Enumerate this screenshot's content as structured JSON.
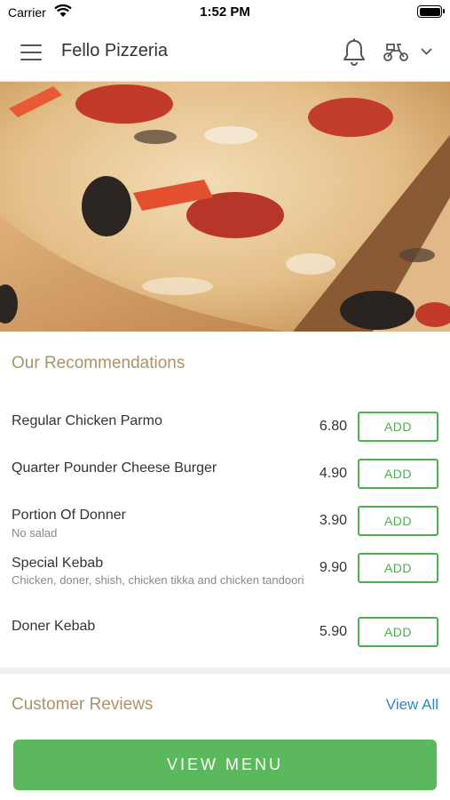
{
  "status_bar": {
    "carrier": "Carrier",
    "time": "1:52 PM"
  },
  "header": {
    "title": "Fello Pizzeria",
    "icons": [
      "menu-icon",
      "bell-icon",
      "delivery-scooter-icon",
      "chevron-down-icon"
    ]
  },
  "hero": {
    "image": "pizza-photo"
  },
  "recommendations": {
    "title": "Our Recommendations",
    "items": [
      {
        "name": "Regular Chicken Parmo",
        "description": "",
        "price": "6.80",
        "button": "ADD"
      },
      {
        "name": "Quarter Pounder Cheese Burger",
        "description": "",
        "price": "4.90",
        "button": "ADD"
      },
      {
        "name": "Portion Of Donner",
        "description": "No salad",
        "price": "3.90",
        "button": "ADD"
      },
      {
        "name": "Special Kebab",
        "description": "Chicken, doner, shish, chicken tikka and chicken tandoori",
        "price": "9.90",
        "button": "ADD"
      },
      {
        "name": "Doner Kebab",
        "description": "",
        "price": "5.90",
        "button": "ADD"
      }
    ]
  },
  "reviews": {
    "title": "Customer Reviews",
    "view_all": "View All"
  },
  "footer": {
    "view_menu": "VIEW MENU"
  },
  "colors": {
    "accent_green": "#4caf50",
    "section_title": "#a89468",
    "link_blue": "#2f88c4"
  }
}
